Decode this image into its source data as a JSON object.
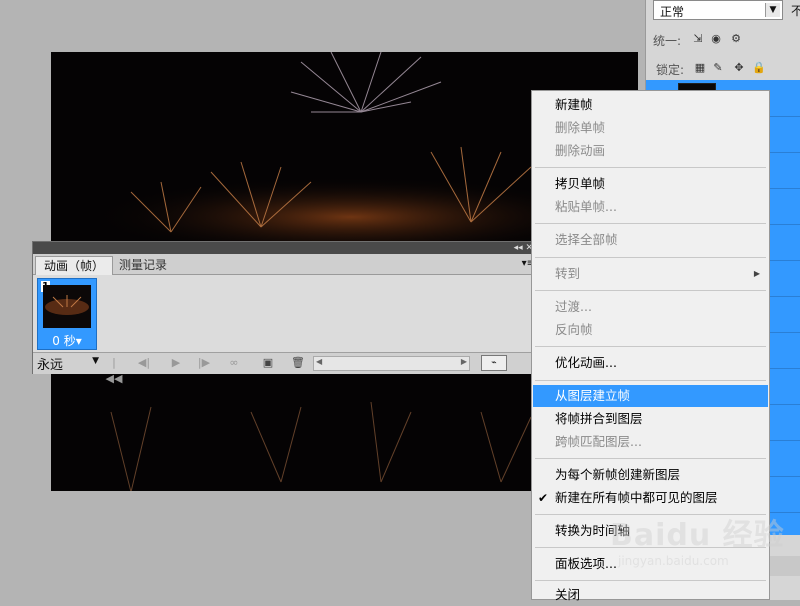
{
  "layers_panel": {
    "blend_mode": "正常",
    "opacity_label_partial": "不",
    "unify_label": "统一:",
    "lock_label": "锁定:"
  },
  "animation_panel": {
    "tabs": [
      {
        "label": "动画（帧）"
      },
      {
        "label": "测量记录"
      }
    ],
    "frames": [
      {
        "number": "1",
        "delay": "0 秒"
      }
    ],
    "loop_option": "永远"
  },
  "context_menu": {
    "items": [
      {
        "label": "新建帧",
        "enabled": true
      },
      {
        "label": "删除单帧",
        "enabled": false
      },
      {
        "label": "删除动画",
        "enabled": false
      },
      {
        "label": "拷贝单帧",
        "enabled": true
      },
      {
        "label": "粘贴单帧...",
        "enabled": false
      },
      {
        "label": "选择全部帧",
        "enabled": false
      },
      {
        "label": "转到",
        "enabled": false,
        "submenu": true
      },
      {
        "label": "过渡...",
        "enabled": false
      },
      {
        "label": "反向帧",
        "enabled": false
      },
      {
        "label": "优化动画...",
        "enabled": true
      },
      {
        "label": "从图层建立帧",
        "enabled": true,
        "highlighted": true
      },
      {
        "label": "将帧拼合到图层",
        "enabled": true
      },
      {
        "label": "跨帧匹配图层...",
        "enabled": false
      },
      {
        "label": "为每个新帧创建新图层",
        "enabled": true
      },
      {
        "label": "新建在所有帧中都可见的图层",
        "enabled": true,
        "checked": true
      },
      {
        "label": "转换为时间轴",
        "enabled": true
      },
      {
        "label": "面板选项...",
        "enabled": true
      },
      {
        "label": "关闭",
        "enabled": true
      }
    ]
  },
  "watermark": {
    "brand": "Baidu 经验",
    "url": "jingyan.baidu.com"
  },
  "colors": {
    "highlight": "#3399ff",
    "menu_bg": "#f0f0f0",
    "workspace_bg": "#b4b4b4"
  }
}
